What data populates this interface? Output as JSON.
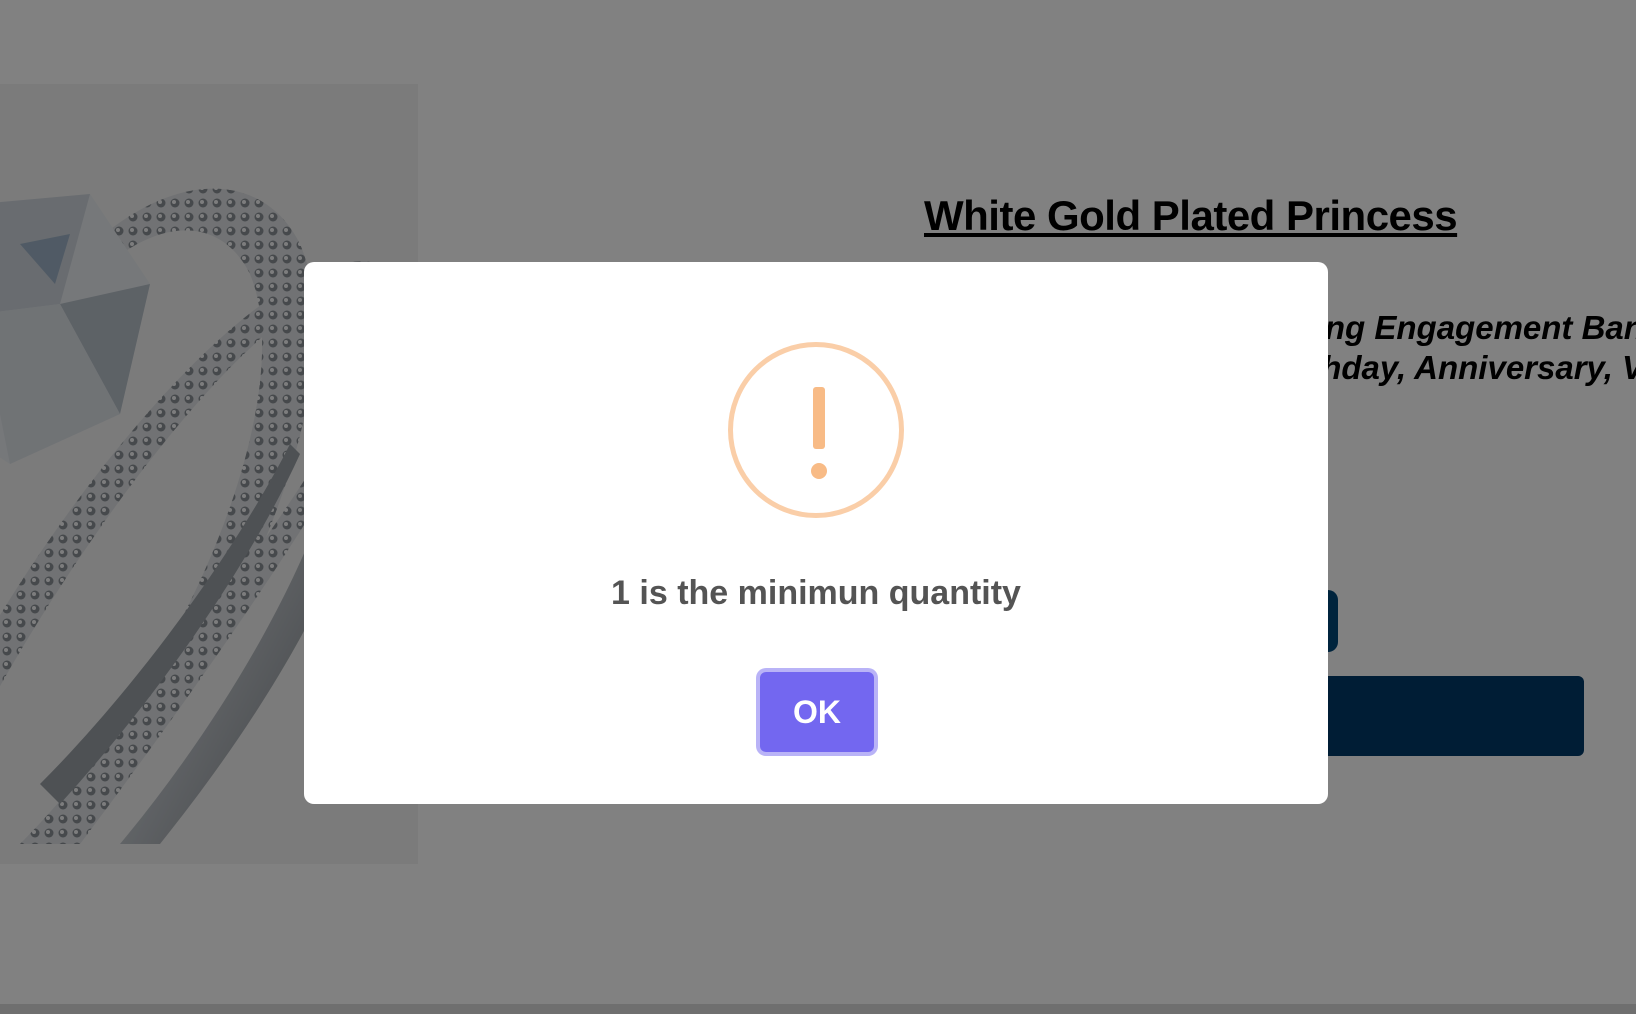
{
  "product": {
    "title": "White Gold Plated Princess",
    "subtitle_line1": "Cut Cubic Zirconia Wedding Engagement Band Promise Ring for Her",
    "subtitle_line2": "Women Girls, Gift for Birthday, Anniversary, Valentine's"
  },
  "dialog": {
    "icon": "warning-icon",
    "message": "1 is the minimun quantity",
    "ok_label": "OK"
  },
  "colors": {
    "overlay": "#000000",
    "ok_button": "#7367f0",
    "warning_icon": "#f8bb86",
    "primary_button": "#00477a"
  }
}
